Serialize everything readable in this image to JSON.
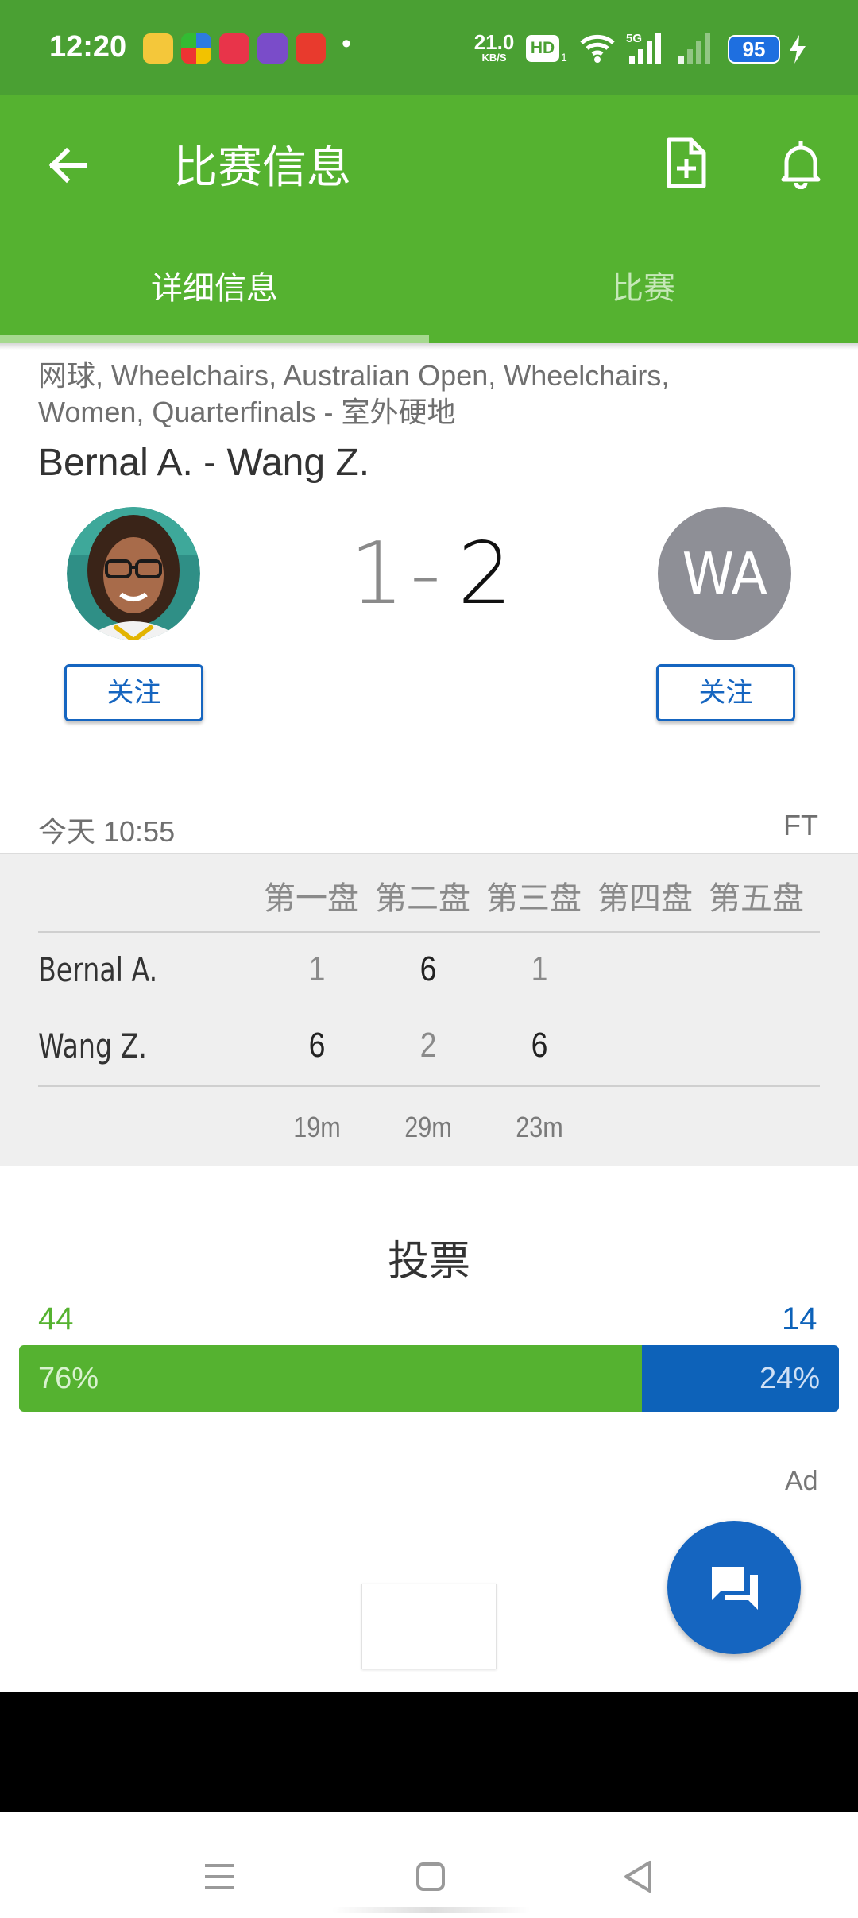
{
  "status_bar": {
    "time": "12:20",
    "net_speed_value": "21.0",
    "net_speed_unit": "KB/S",
    "hd_label": "HD",
    "sim_index": "1",
    "network_type": "5G",
    "battery": "95",
    "dot": "•"
  },
  "app_bar": {
    "title": "比赛信息",
    "tabs": [
      {
        "label": "详细信息",
        "active": true
      },
      {
        "label": "比赛",
        "active": false
      }
    ]
  },
  "match": {
    "breadcrumb_line1": "网球, Wheelchairs, Australian Open, Wheelchairs,",
    "breadcrumb_line2": "Women, Quarterfinals - 室外硬地",
    "title": "Bernal A. - Wang Z.",
    "home_initials": "",
    "away_initials": "WA",
    "home_score": "1",
    "score_separator": "-",
    "away_score": "2",
    "follow_label": "关注",
    "time": "今天 10:55",
    "status": "FT"
  },
  "sets": {
    "headers": [
      "第一盘",
      "第二盘",
      "第三盘",
      "第四盘",
      "第五盘"
    ],
    "players": [
      {
        "name": "Bernal A.",
        "scores": [
          "1",
          "6",
          "1"
        ]
      },
      {
        "name": "Wang Z.",
        "scores": [
          "6",
          "2",
          "6"
        ]
      }
    ],
    "durations": [
      "19m",
      "29m",
      "23m"
    ]
  },
  "vote": {
    "title": "投票",
    "home_count": "44",
    "away_count": "14",
    "home_percent": "76%",
    "away_percent": "24%",
    "home_fraction": 0.76
  },
  "ad_label": "Ad",
  "colors": {
    "status_green": "#4aa033",
    "app_green": "#55b230",
    "accent_blue": "#1565c0",
    "vote_blue": "#0d62b9",
    "vote_home_count": "#55b230",
    "vote_away_count": "#0d62b9"
  },
  "icons": [
    "back-arrow-icon",
    "add-document-icon",
    "bell-icon",
    "chat-icon",
    "menu-icon",
    "home-icon",
    "back-triangle-icon",
    "wifi-icon",
    "signal-icon",
    "charging-icon"
  ]
}
